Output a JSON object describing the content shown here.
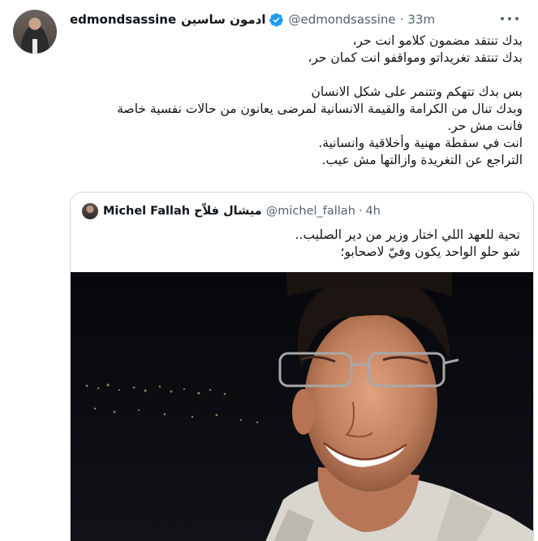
{
  "tweet": {
    "author_name_latin": "edmondsassine",
    "author_name_arabic": "ادمون ساسين",
    "handle": "@edmondsassine",
    "separator": "·",
    "time": "33m",
    "verified_icon": "verified-badge-icon",
    "more_icon": "more-options-icon",
    "lines": [
      "بدك تنتقد مضمون كلامو انت حر،",
      "بدك تنتقد تغريداتو ومواقفو انت كمان حر،",
      "",
      "بس بدك تتهكم وتتنمر على شكل الانسان",
      "وبدك تنال من الكرامة والقيمة الانسانية لمرضى يعانون من حالات نفسية خاصة",
      "فانت مش حر.",
      "انت في سقطة مهنية وأخلاقية وانسانية.",
      "التراجع عن التغريدة وازالتها مش عيب."
    ]
  },
  "quoted_tweet": {
    "author_name_latin": "Michel Fallah",
    "author_name_arabic": "ميشال فلاّح",
    "handle": "@michel_fallah",
    "separator": "·",
    "time": "4h",
    "lines": [
      "تحية للعهد اللي اختار وزير من دير الصليب..",
      "شو حلو الواحد يكون وفيّ لاصحابو؛"
    ]
  },
  "colors": {
    "text_primary": "#0f1419",
    "text_secondary": "#536471",
    "border": "#cfd9de",
    "verified_blue": "#1d9bf0"
  }
}
